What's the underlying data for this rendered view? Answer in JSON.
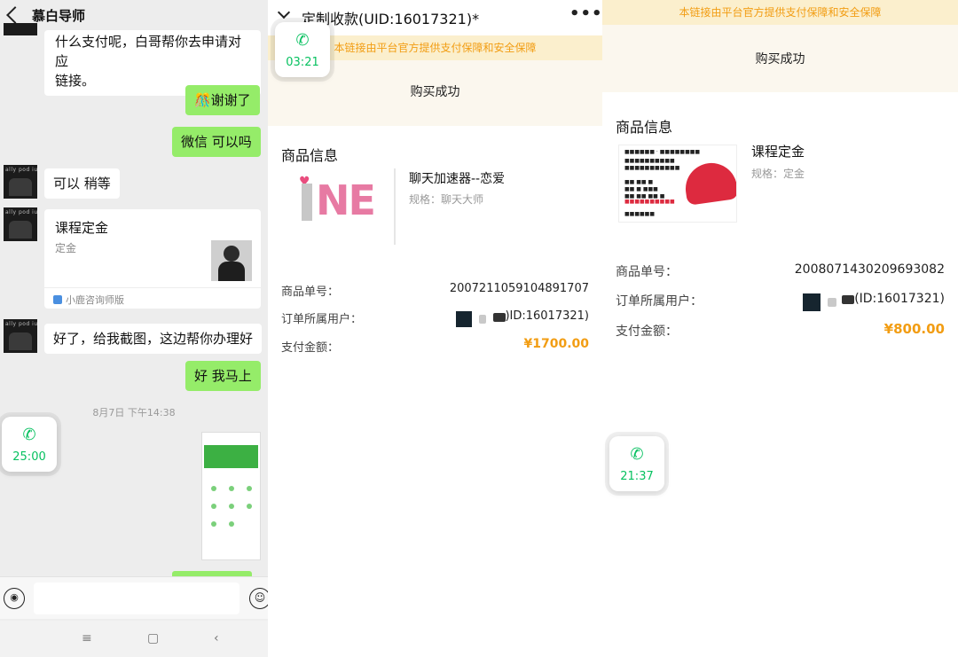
{
  "chat": {
    "title": "慕白导师",
    "messages": [
      {
        "text": "什么支付呢，白哥帮你去申请对应链接。",
        "line1": "什么支付呢，白哥帮你去申请对应",
        "line2": "链接。"
      },
      {
        "text": "🎊谢谢了"
      },
      {
        "text": "微信 可以吗"
      },
      {
        "text": "可以 稍等"
      },
      {
        "text": "好了，给我截图，这边帮你办理好"
      },
      {
        "text": "好 我马上"
      }
    ],
    "card": {
      "title": "课程定金",
      "subtitle": "定金",
      "source": "小鹿咨询师版"
    },
    "timestamp": "8月7日 下午14:38",
    "call_times": [
      "25:00"
    ]
  },
  "payment1": {
    "header_title": "定制收款(UID:16017321)*",
    "call_time": "03:21",
    "notice": "本链接由平台官方提供支付保障和安全保障",
    "status": "购买成功",
    "section_title": "商品信息",
    "product_name": "聊天加速器--恋爱",
    "product_spec": "规格：聊天大师",
    "order_no_label": "商品单号：",
    "order_no": "2007211059104891707",
    "user_label": "订单所属用户：",
    "user_value": ")ID:16017321)",
    "amount_label": "支付金额：",
    "amount": "¥1700.00",
    "logo_text": "NE"
  },
  "payment2": {
    "notice": "本链接由平台官方提供支付保障和安全保障",
    "status": "购买成功",
    "section_title": "商品信息",
    "product_name": "课程定金",
    "product_spec": "规格：定金",
    "order_no_label": "商品单号：",
    "order_no": "2008071430209693082",
    "user_label": "订单所属用户：",
    "user_value": "(ID:16017321)",
    "amount_label": "支付金额：",
    "amount": "¥800.00",
    "call_time": "21:37"
  },
  "colors": {
    "wechat_green": "#95ec69",
    "call_green": "#07c160",
    "notice_orange": "#f29d13",
    "notice_bg": "#fbefcd"
  },
  "icons": [
    "back-arrow-icon",
    "phone-icon",
    "voice-icon",
    "emoji-icon",
    "more-icon",
    "chevron-down-icon"
  ]
}
